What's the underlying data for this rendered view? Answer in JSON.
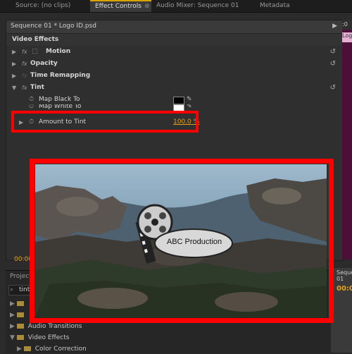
{
  "tabs": [
    {
      "label": "Source: (no clips)"
    },
    {
      "label": "Effect Controls"
    },
    {
      "label": "Audio Mixer: Sequence 01"
    },
    {
      "label": "Metadata"
    }
  ],
  "tab_close": "⊗",
  "sequence_label": "Sequence 01 * Logo ID.psd",
  "sequence_arrow": "▶",
  "timeline_clip": "Logo",
  "section_title": "Video Effects",
  "effects": [
    {
      "label": "Motion"
    },
    {
      "label": "Opacity"
    },
    {
      "label": "Time Remapping"
    },
    {
      "label": "Tint"
    }
  ],
  "tint_params": {
    "map_black": "Map Black To",
    "map_white": "Map White To",
    "amount": "Amount to Tint",
    "amount_value": "100.0",
    "amount_unit": "%"
  },
  "fx_glyph": "fx",
  "colors": {
    "black_swatch": "#000000",
    "white_swatch": "#ffffff",
    "value": "#e8a317",
    "highlight": "#ff0000"
  },
  "timecode": "00:00",
  "bottom": {
    "project_tab": "Project",
    "search_value": "tint",
    "items": [
      {
        "label": "Audio Transitions"
      },
      {
        "label": "Video Effects"
      },
      {
        "label": "Color Correction"
      }
    ],
    "right_tab": "Sequence 01",
    "right_timecode": "00:0"
  },
  "preview": {
    "logo_text": "ABC Production"
  }
}
